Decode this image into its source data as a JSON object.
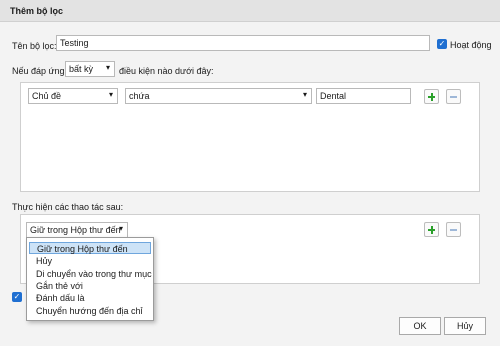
{
  "window": {
    "title": "Thêm bộ lọc"
  },
  "filter_name": {
    "label": "Tên bộ lọc:",
    "value": "Testing"
  },
  "active": {
    "label": "Hoạt động",
    "checked": true
  },
  "match": {
    "prefix": "Nếu đáp ứng",
    "selected": "bất kỳ",
    "suffix": "điều kiện nào dưới đây:"
  },
  "condition": {
    "field": "Chủ đề",
    "operator": "chứa",
    "value": "Dental"
  },
  "actions": {
    "label": "Thực hiện các thao tác sau:",
    "selected": "Giữ trong Hộp thư đến",
    "options": [
      "Giữ trong Hộp thư đến",
      "Hủy",
      "Di chuyển vào trong thư mục",
      "Gắn thẻ với",
      "Đánh dấu là",
      "Chuyển hướng đến địa chỉ"
    ]
  },
  "buttons": {
    "ok": "OK",
    "cancel": "Hủy"
  },
  "colors": {
    "accent": "#1f6fd1",
    "plus": "#2aa02a",
    "selection": "#cde3f7"
  },
  "icons": {
    "add": "plus-icon",
    "remove": "minus-icon",
    "dropdown": "chevron-down-icon",
    "check": "checkmark-icon"
  }
}
